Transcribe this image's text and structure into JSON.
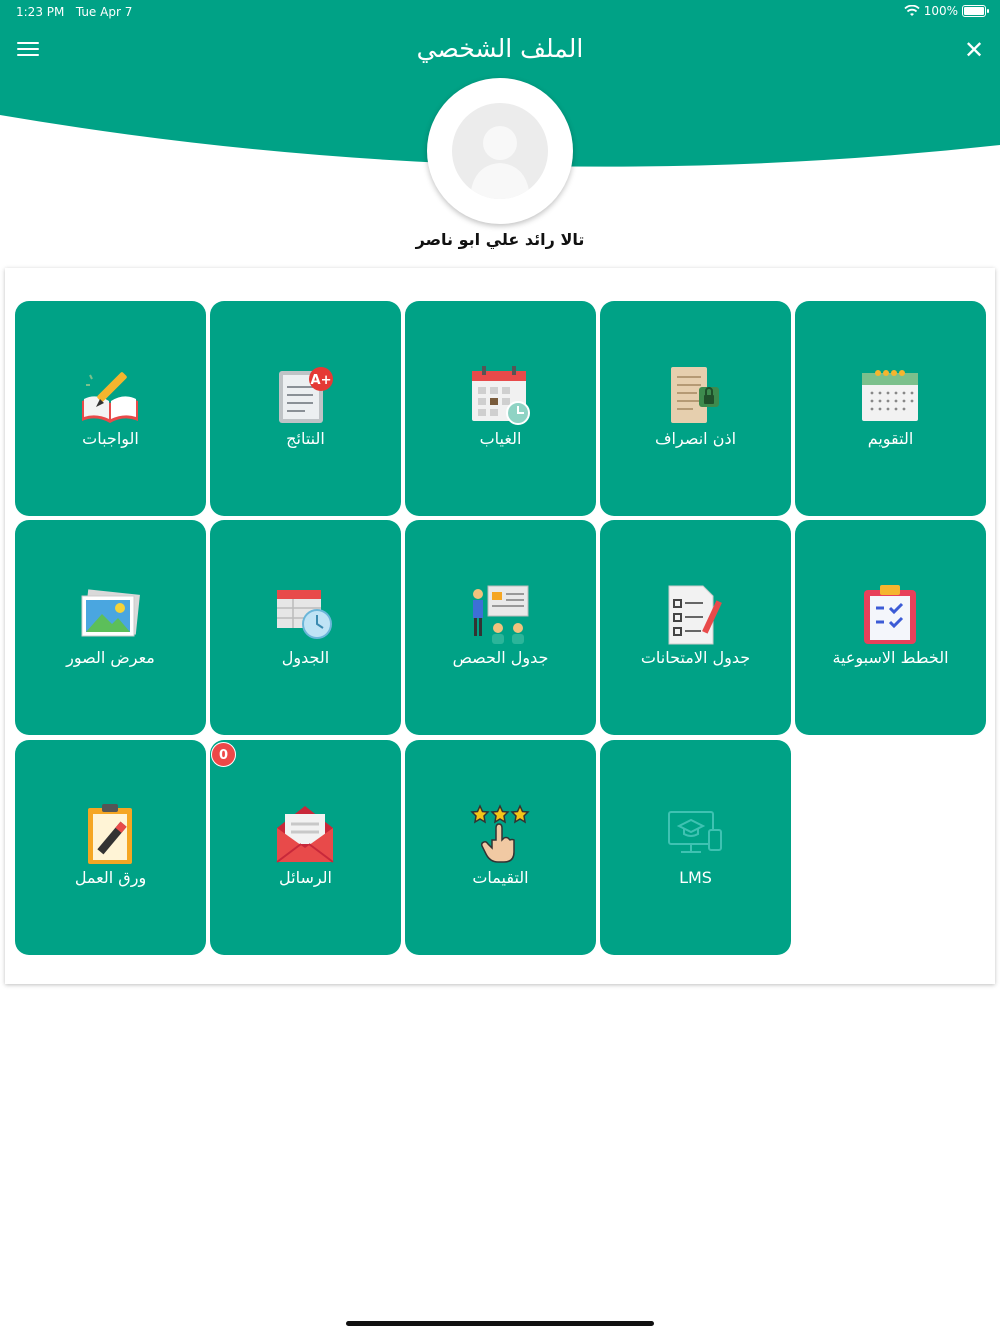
{
  "status_bar": {
    "time": "1:23 PM",
    "date": "Tue Apr 7",
    "battery": "100%",
    "battery_level": 1.0
  },
  "header": {
    "title": "الملف الشخصي",
    "menu_icon": "hamburger-icon",
    "close_icon": "close-icon",
    "background": "#00a286"
  },
  "profile": {
    "name": "تالا رائد علي ابو ناصر",
    "avatar_icon": "avatar-placeholder-icon"
  },
  "tiles": [
    {
      "label": "التقويم",
      "icon": "calendar-icon"
    },
    {
      "label": "اذن انصراف",
      "icon": "leave-permission-icon"
    },
    {
      "label": "الغياب",
      "icon": "absence-calendar-icon"
    },
    {
      "label": "النتائج",
      "icon": "results-icon"
    },
    {
      "label": "الواجبات",
      "icon": "homework-icon"
    },
    {
      "label": "الخطط الاسبوعية",
      "icon": "weekly-plan-icon"
    },
    {
      "label": "جدول الامتحانات",
      "icon": "exam-schedule-icon"
    },
    {
      "label": "جدول الحصص",
      "icon": "class-schedule-icon"
    },
    {
      "label": "الجدول",
      "icon": "timetable-icon"
    },
    {
      "label": "معرض الصور",
      "icon": "gallery-icon"
    },
    {
      "label": "LMS",
      "icon": "lms-icon"
    },
    {
      "label": "التقيمات",
      "icon": "ratings-icon"
    },
    {
      "label": "الرسائل",
      "icon": "messages-icon",
      "badge": "0"
    },
    {
      "label": "ورق العمل",
      "icon": "worksheet-icon"
    }
  ],
  "colors": {
    "tile": "#00a286",
    "badge": "#ee4848"
  }
}
